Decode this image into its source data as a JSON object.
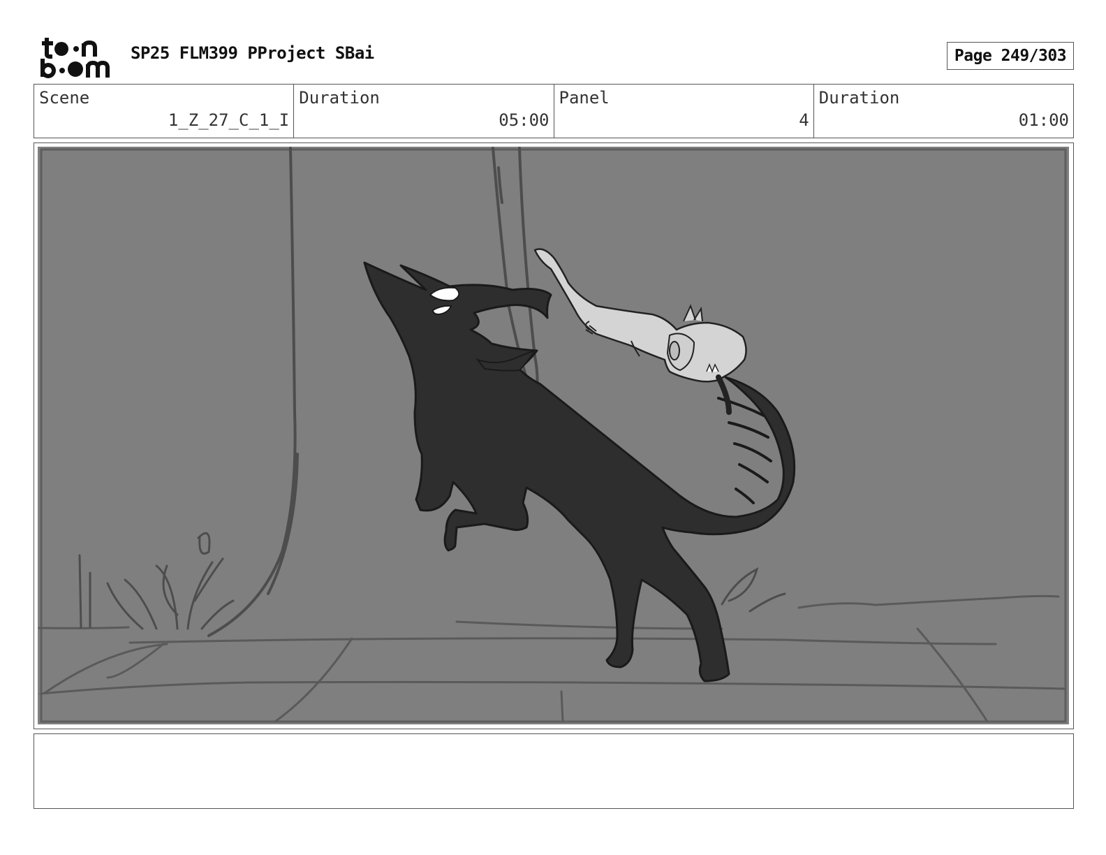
{
  "logo": {
    "line1": "toon",
    "line2": "boom"
  },
  "header": {
    "project_title": "SP25 FLM399 PProject SBai",
    "page_label": "Page 249/303"
  },
  "info": {
    "scene_label": "Scene",
    "scene_value": "1_Z_27_C_1_I",
    "scene_duration_label": "Duration",
    "scene_duration_value": "05:00",
    "panel_label": "Panel",
    "panel_value": "4",
    "panel_duration_label": "Duration",
    "panel_duration_value": "01:00"
  },
  "notes": {
    "text": ""
  }
}
